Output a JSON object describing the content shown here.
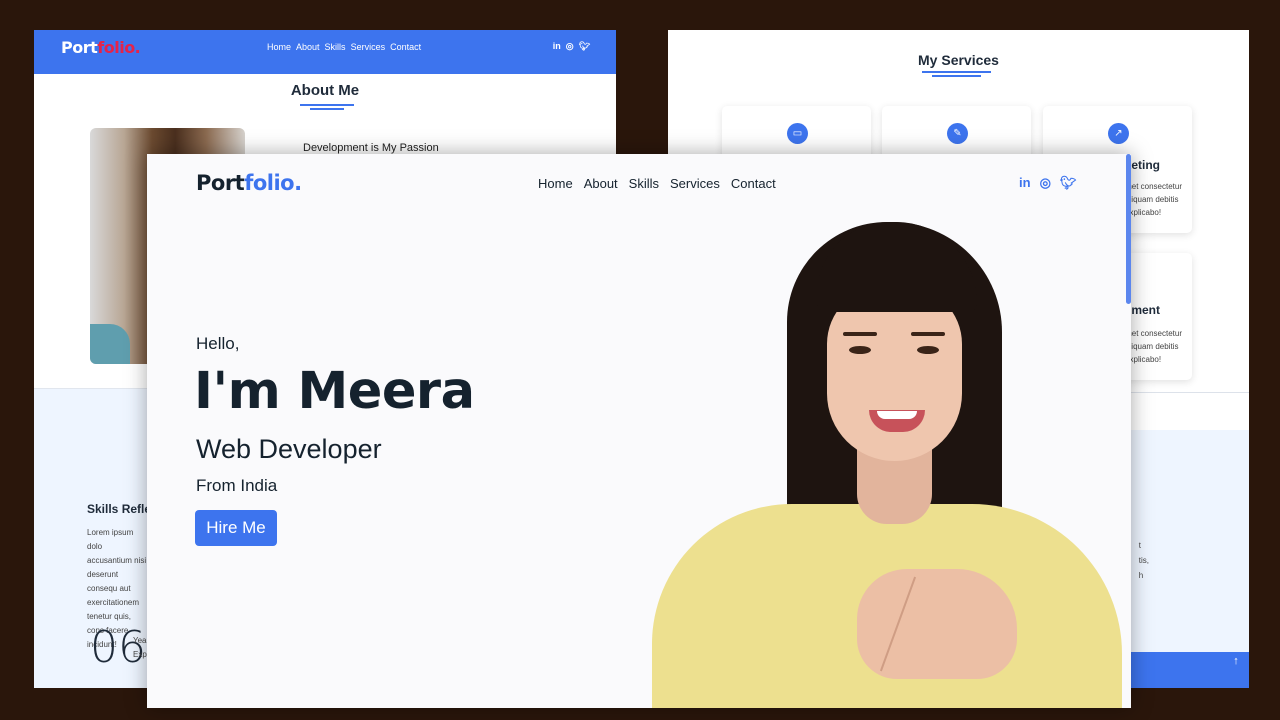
{
  "about_page": {
    "logo_prefix": "Port",
    "logo_suffix": "folio.",
    "nav": [
      "Home",
      "About",
      "Skills",
      "Services",
      "Contact"
    ],
    "social_icons": [
      "linkedin-icon",
      "instagram-icon",
      "twitter-icon"
    ],
    "title": "About Me",
    "subtitle": "Development is My Passion",
    "skills_title": "Skills Reflect",
    "skills_text": "Lorem ipsum dolo accusantium nisi deserunt consequ aut exercitationem tenetur quis, cons facere incidunt!",
    "years_number": "06",
    "years_label_line1": "Yea",
    "years_label_line2": "Exp"
  },
  "services_page": {
    "title": "My Services",
    "card_icons": [
      "desktop-icon",
      "brush-icon",
      "chart-icon"
    ],
    "card_heading_marketing": "keting",
    "card_heading_development": "pment",
    "card_text_line1": "met consectetur",
    "card_text_line2": "aliquam debitis",
    "card_text_line3": "explicabo!",
    "band_text_line1": "t",
    "band_text_line2": "tis,",
    "band_text_line3": "h"
  },
  "home_page": {
    "logo_prefix": "Port",
    "logo_suffix": "folio.",
    "nav": [
      "Home",
      "About",
      "Skills",
      "Services",
      "Contact"
    ],
    "social_icons": [
      "linkedin-icon",
      "instagram-icon",
      "twitter-icon"
    ],
    "greeting": "Hello,",
    "name": "I'm Meera",
    "role": "Web Developer",
    "location": "From India",
    "cta_label": "Hire Me"
  },
  "colors": {
    "accent": "#3d74ee",
    "logo_accent_red": "#e5234a",
    "dark_text": "#15222e",
    "backdrop": "#2a160b"
  }
}
